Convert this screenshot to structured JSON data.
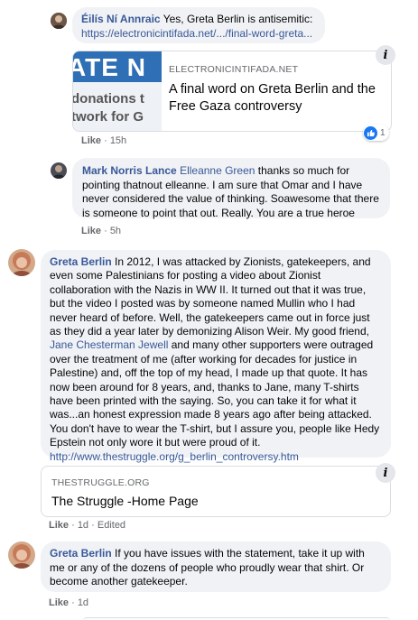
{
  "comments": [
    {
      "author": "Éilís Ní Annraic",
      "text": " Yes, Greta Berlin is antisemitic:",
      "link": "https://electronicintifada.net/.../final-word-greta...",
      "preview": {
        "image_text_big": "ATE N",
        "image_text_line1": "donations t",
        "image_text_line2": "twork for G",
        "domain": "ELECTRONICINTIFADA.NET",
        "title": "A final word on Greta Berlin and the Free Gaza controversy"
      },
      "meta": {
        "like": "Like",
        "time": "15h"
      },
      "reactions": {
        "count": "1"
      }
    },
    {
      "author": "Mark Norris Lance",
      "mention": "Elleanne Green",
      "text": " thanks so much for pointing thatnout elleanne. I am sure that Omar and I have never considered the value of thinking. Soawesome that there is someone to point that out. Really. You are a true heroe",
      "meta": {
        "like": "Like",
        "time": "5h"
      }
    },
    {
      "author": "Greta Berlin",
      "text1": " In 2012, I was attacked by Zionists, gatekeepers, and even some Palestinians for posting a video about Zionist collaboration with the Nazis in WW II. It turned out that it was true, but the video I posted was by someone named Mullin who I had never heard of before. Well, the gatekeepers came out in force just as they did a year later by demonizing Alison Weir. My good friend, ",
      "mention": "Jane Chesterman Jewell",
      "text2": " and many other supporters were outraged over the treatment of me (after working for decades for justice in Palestine) and, off the top of my head, I made up that quote. It has now been around for 8 years, and, thanks to Jane, many T-shirts have been printed with the saying. So, you can take it for what it was...an honest expression made 8 years ago after being attacked. You don't have to wear the T-shirt, but I assure you, people like Hedy Epstein not only wore it but were proud of it.",
      "link": "http://www.thestruggle.org/g_berlin_controversy.htm",
      "preview": {
        "domain": "THESTRUGGLE.ORG",
        "title": "The Struggle -Home Page"
      },
      "meta": {
        "like": "Like",
        "time": "1d",
        "edited": "Edited"
      }
    },
    {
      "author": "Greta Berlin",
      "text": " If you have issues with the statement, take it up with me or any of the dozens of people who proudly wear that shirt. Or become another gatekeeper.",
      "meta": {
        "like": "Like",
        "time": "1d"
      }
    }
  ],
  "sep": "·",
  "info_glyph": "i",
  "colors": {
    "link": "#385898",
    "bubble": "#f0f2f5",
    "meta": "#65676b",
    "like_blue": "#1877f2"
  }
}
